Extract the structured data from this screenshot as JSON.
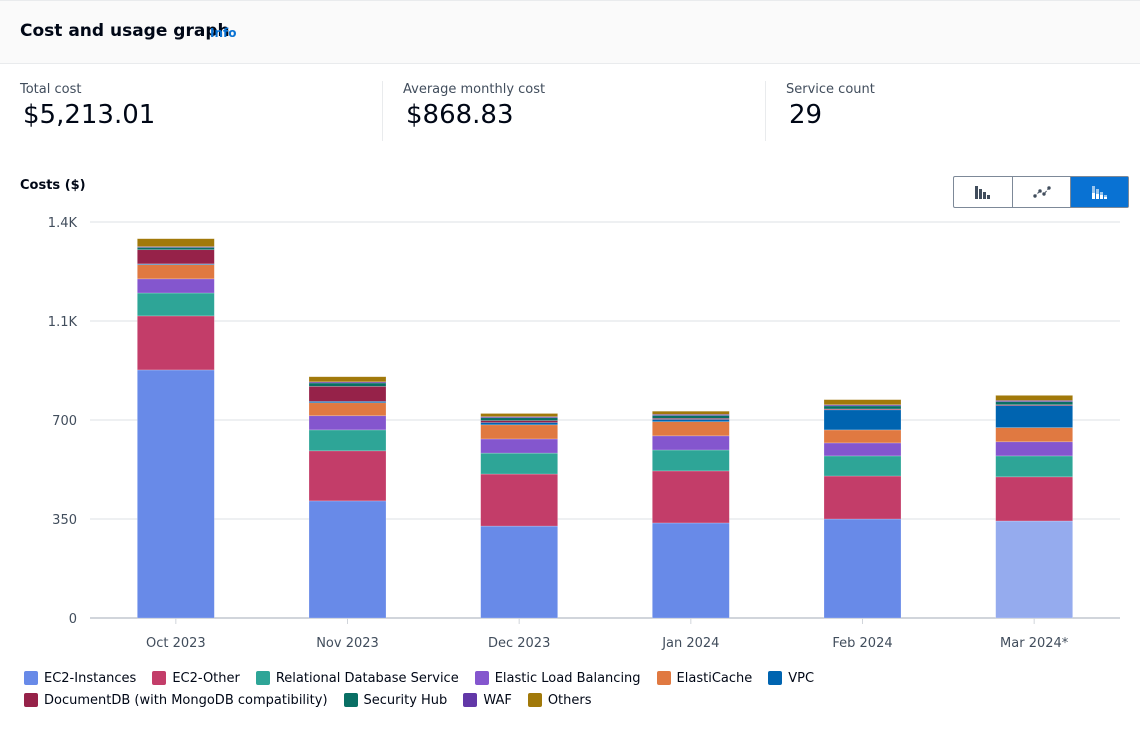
{
  "header": {
    "title": "Cost and usage graph",
    "info_link": "Info"
  },
  "kpis": [
    {
      "label": "Total cost",
      "value": "$5,213.01"
    },
    {
      "label": "Average monthly cost",
      "value": "$868.83"
    },
    {
      "label": "Service count",
      "value": "29"
    }
  ],
  "chart_type_toggle": {
    "options": [
      "bar-chart-icon",
      "line-chart-icon",
      "stacked-bar-chart-icon"
    ],
    "selected": "stacked-bar-chart-icon"
  },
  "chart_data": {
    "type": "bar",
    "stacked": true,
    "title": "",
    "xlabel": "",
    "ylabel": "Costs ($)",
    "ylim": [
      0,
      1400
    ],
    "yticks": [
      0,
      350,
      700,
      1050,
      1400
    ],
    "ytick_labels": [
      "0",
      "350",
      "700",
      "1.1K",
      "1.4K"
    ],
    "grid": true,
    "legend_position": "bottom",
    "categories": [
      "Oct 2023",
      "Nov 2023",
      "Dec 2023",
      "Jan 2024",
      "Feb 2024",
      "Mar 2024*"
    ],
    "forecast_category": "Mar 2024*",
    "series": [
      {
        "name": "EC2-Instances",
        "color": "#688ae8",
        "values": [
          877,
          414,
          325,
          336,
          350,
          343
        ]
      },
      {
        "name": "EC2-Other",
        "color": "#c33d69",
        "values": [
          191,
          177,
          184,
          184,
          152,
          156
        ]
      },
      {
        "name": "Relational Database Service",
        "color": "#2ea597",
        "values": [
          81,
          74,
          74,
          74,
          71,
          74
        ]
      },
      {
        "name": "Elastic Load Balancing",
        "color": "#8456ce",
        "values": [
          50,
          50,
          50,
          50,
          46,
          50
        ]
      },
      {
        "name": "ElastiCache",
        "color": "#e07941",
        "values": [
          50,
          46,
          50,
          50,
          46,
          50
        ]
      },
      {
        "name": "VPC",
        "color": "#0064b0",
        "values": [
          3,
          5,
          8,
          8,
          71,
          78
        ]
      },
      {
        "name": "DocumentDB (with MongoDB compatibility)",
        "color": "#962249",
        "values": [
          50,
          53,
          7,
          4,
          3,
          3
        ]
      },
      {
        "name": "Security Hub",
        "color": "#096f64",
        "values": [
          8,
          12,
          10,
          10,
          11,
          11
        ]
      },
      {
        "name": "WAF",
        "color": "#6237a7",
        "values": [
          3,
          4,
          4,
          4,
          4,
          4
        ]
      },
      {
        "name": "Others",
        "color": "#a1790a",
        "values": [
          28,
          18,
          11,
          11,
          18,
          18
        ]
      }
    ]
  }
}
